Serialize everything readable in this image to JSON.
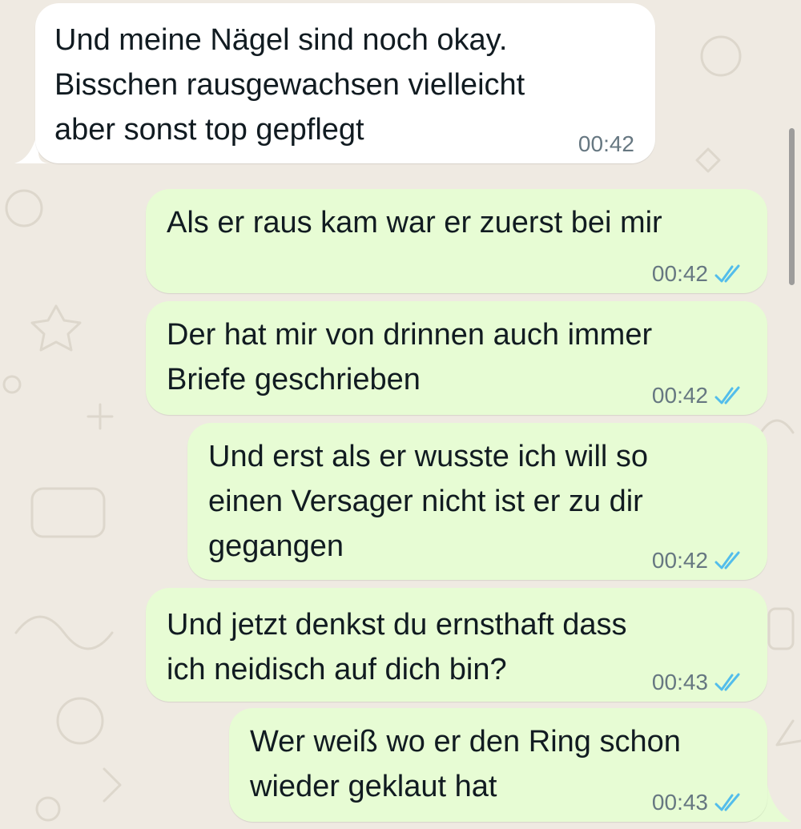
{
  "colors": {
    "background": "#efeae2",
    "incoming_bubble": "#ffffff",
    "outgoing_bubble": "#e7fcd4",
    "read_ticks": "#53bdeb",
    "time_text": "#667781"
  },
  "messages": [
    {
      "direction": "incoming",
      "text": "Und meine Nägel sind noch okay.\nBisschen rausgewachsen vielleicht\naber sonst top gepflegt",
      "time": "00:42"
    },
    {
      "direction": "outgoing",
      "text": "Als er raus kam war er zuerst bei mir",
      "time": "00:42",
      "status_icon": "double-check-read-icon"
    },
    {
      "direction": "outgoing",
      "text": "Der hat mir von drinnen auch immer\nBriefe geschrieben",
      "time": "00:42",
      "status_icon": "double-check-read-icon"
    },
    {
      "direction": "outgoing",
      "text": "Und erst als er wusste ich will so\neinen Versager nicht ist er zu dir\ngegangen",
      "time": "00:42",
      "status_icon": "double-check-read-icon"
    },
    {
      "direction": "outgoing",
      "text": "Und jetzt denkst du ernsthaft dass\nich neidisch auf dich bin?",
      "time": "00:43",
      "status_icon": "double-check-read-icon"
    },
    {
      "direction": "outgoing",
      "text": "Wer weiß wo er den Ring schon\nwieder geklaut hat",
      "time": "00:43",
      "status_icon": "double-check-read-icon"
    }
  ]
}
